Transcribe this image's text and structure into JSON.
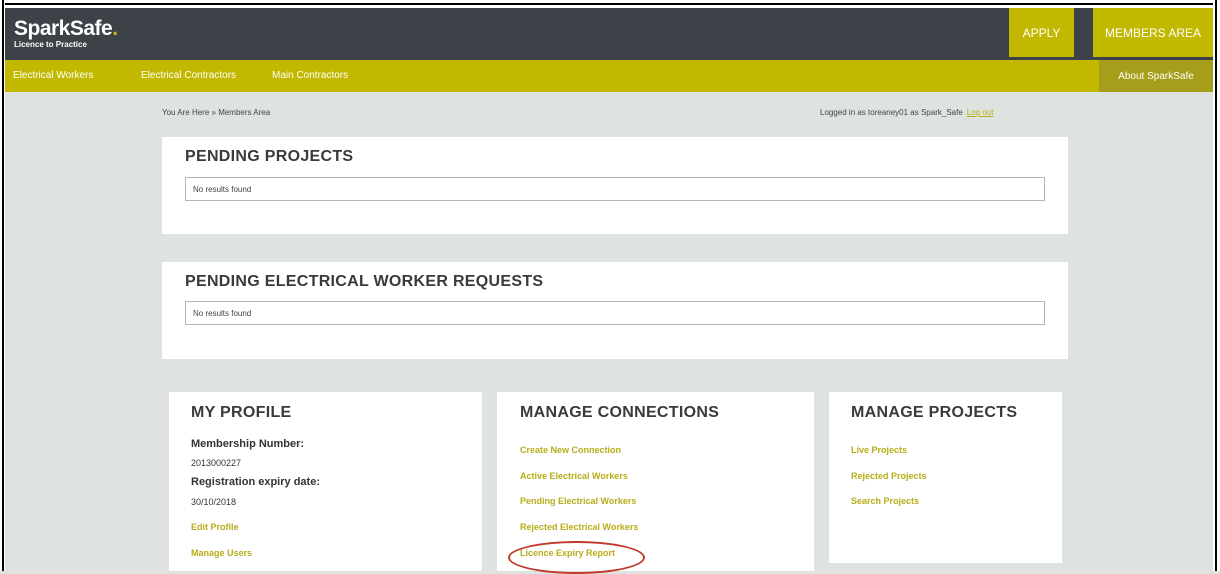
{
  "header": {
    "logo_name": "SparkSafe",
    "logo_dot": ".",
    "logo_tagline": "Licence to Practice",
    "apply_label": "APPLY",
    "members_label": "MEMBERS AREA"
  },
  "nav": {
    "items": [
      "Electrical Workers",
      "Electrical Contractors",
      "Main Contractors"
    ],
    "about": "About SparkSafe"
  },
  "breadcrumb": "You Are Here » Members Area",
  "login": {
    "text": "Logged in as toreaney01 as Spark_Safe",
    "logout": "Log out"
  },
  "pending_projects": {
    "title": "PENDING PROJECTS",
    "result": "No results found"
  },
  "pending_workers": {
    "title": "PENDING ELECTRICAL WORKER REQUESTS",
    "result": "No results found"
  },
  "profile": {
    "title": "MY PROFILE",
    "membership_label": "Membership Number:",
    "membership_value": "2013000227",
    "expiry_label": "Registration expiry date:",
    "expiry_value": "30/10/2018",
    "links": [
      "Edit Profile",
      "Manage Users"
    ]
  },
  "connections": {
    "title": "MANAGE CONNECTIONS",
    "links": [
      "Create New Connection",
      "Active Electrical Workers",
      "Pending Electrical Workers",
      "Rejected Electrical Workers",
      "Licence Expiry Report"
    ]
  },
  "projects": {
    "title": "MANAGE PROJECTS",
    "links": [
      "Live Projects",
      "Rejected Projects",
      "Search Projects"
    ]
  },
  "colors": {
    "accent": "#c2b800",
    "header_bg": "#3c4247",
    "page_bg": "#dfe3df",
    "highlight": "#c0392b"
  }
}
